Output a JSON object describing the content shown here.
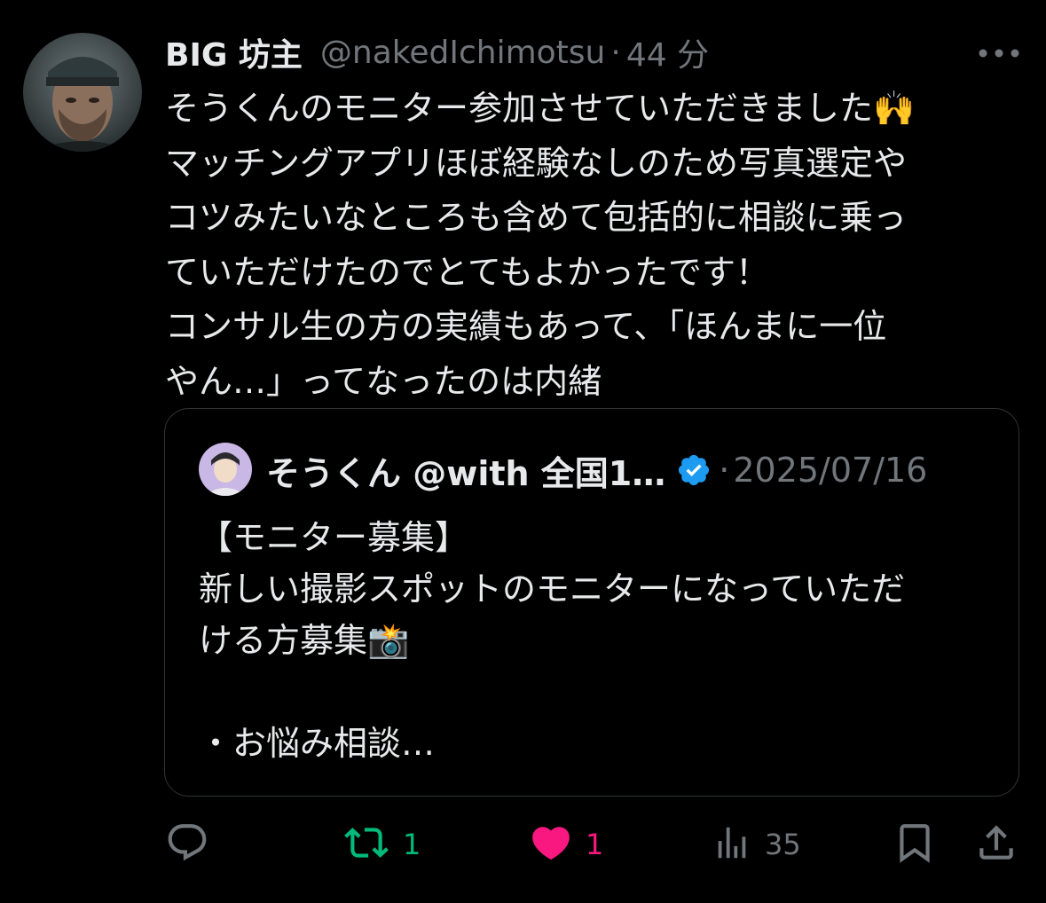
{
  "tweet": {
    "display_name": "BIG 坊主",
    "handle": "@nakedIchimotsu",
    "separator": "·",
    "time": "44 分",
    "body_lines": [
      "そうくんのモニター参加させていただきました🙌",
      "マッチングアプリほぼ経験なしのため写真選定や",
      "コツみたいなところも含めて包括的に相談に乗っ",
      "ていただけたのでとてもよかったです！",
      "コンサル生の方の実績もあって、「ほんまに一位",
      "やん…」ってなったのは内緒"
    ]
  },
  "quote": {
    "display_name": "そうくん @with 全国1…",
    "separator": "·",
    "date": "2025/07/16",
    "body_lines": [
      "【モニター募集】",
      "新しい撮影スポットのモニターになっていただ",
      "ける方募集📸",
      "",
      "・お悩み相談…"
    ]
  },
  "actions": {
    "reply_icon": "reply-icon",
    "retweet_icon": "retweet-icon",
    "retweet_count": "1",
    "like_icon": "heart-icon",
    "like_count": "1",
    "views_icon": "views-icon",
    "views_count": "35",
    "bookmark_icon": "bookmark-icon",
    "share_icon": "share-icon"
  },
  "colors": {
    "background": "#000000",
    "text": "#e7e9ea",
    "secondary": "#71767b",
    "border": "#2f3336",
    "retweet_green": "#00ba7c",
    "like_pink": "#f91880",
    "verified_blue": "#1d9bf0"
  }
}
